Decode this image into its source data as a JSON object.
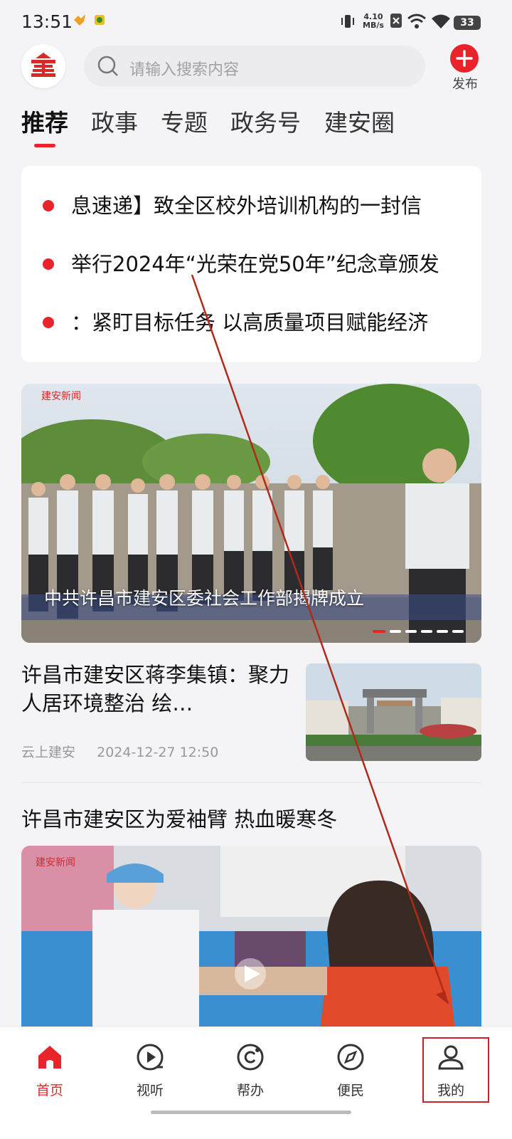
{
  "status_bar": {
    "time": "13:51",
    "net_speed_value": "4.10",
    "net_speed_unit": "MB/s",
    "battery": "33"
  },
  "header": {
    "search_placeholder": "请输入搜索内容",
    "publish_label": "发布"
  },
  "tabs": [
    "推荐",
    "政事",
    "专题",
    "政务号",
    "建安圈"
  ],
  "headlines": [
    "息速递】致全区校外培训机构的一封信",
    "举行2024年“光荣在党50年”纪念章颁发",
    "：紧盯目标任务 以高质量项目赋能经济"
  ],
  "banner": {
    "caption": "中共许昌市建安区委社会工作部揭牌成立",
    "slide_count": 6,
    "active_slide": 0
  },
  "articles": [
    {
      "title": "许昌市建安区蒋李集镇：聚力人居环境整治 绘…",
      "source": "云上建安",
      "time": "2024-12-27 12:50"
    },
    {
      "title": "许昌市建安区为爱袖臂  热血暖寒冬"
    }
  ],
  "bottom_nav": [
    {
      "label": "首页",
      "icon": "home-icon",
      "active": true
    },
    {
      "label": "视听",
      "icon": "play-icon",
      "active": false
    },
    {
      "label": "帮办",
      "icon": "help-icon",
      "active": false
    },
    {
      "label": "便民",
      "icon": "compass-icon",
      "active": false
    },
    {
      "label": "我的",
      "icon": "profile-icon",
      "active": false
    }
  ],
  "colors": {
    "accent": "#e8242a",
    "background": "#f4f4f6"
  }
}
